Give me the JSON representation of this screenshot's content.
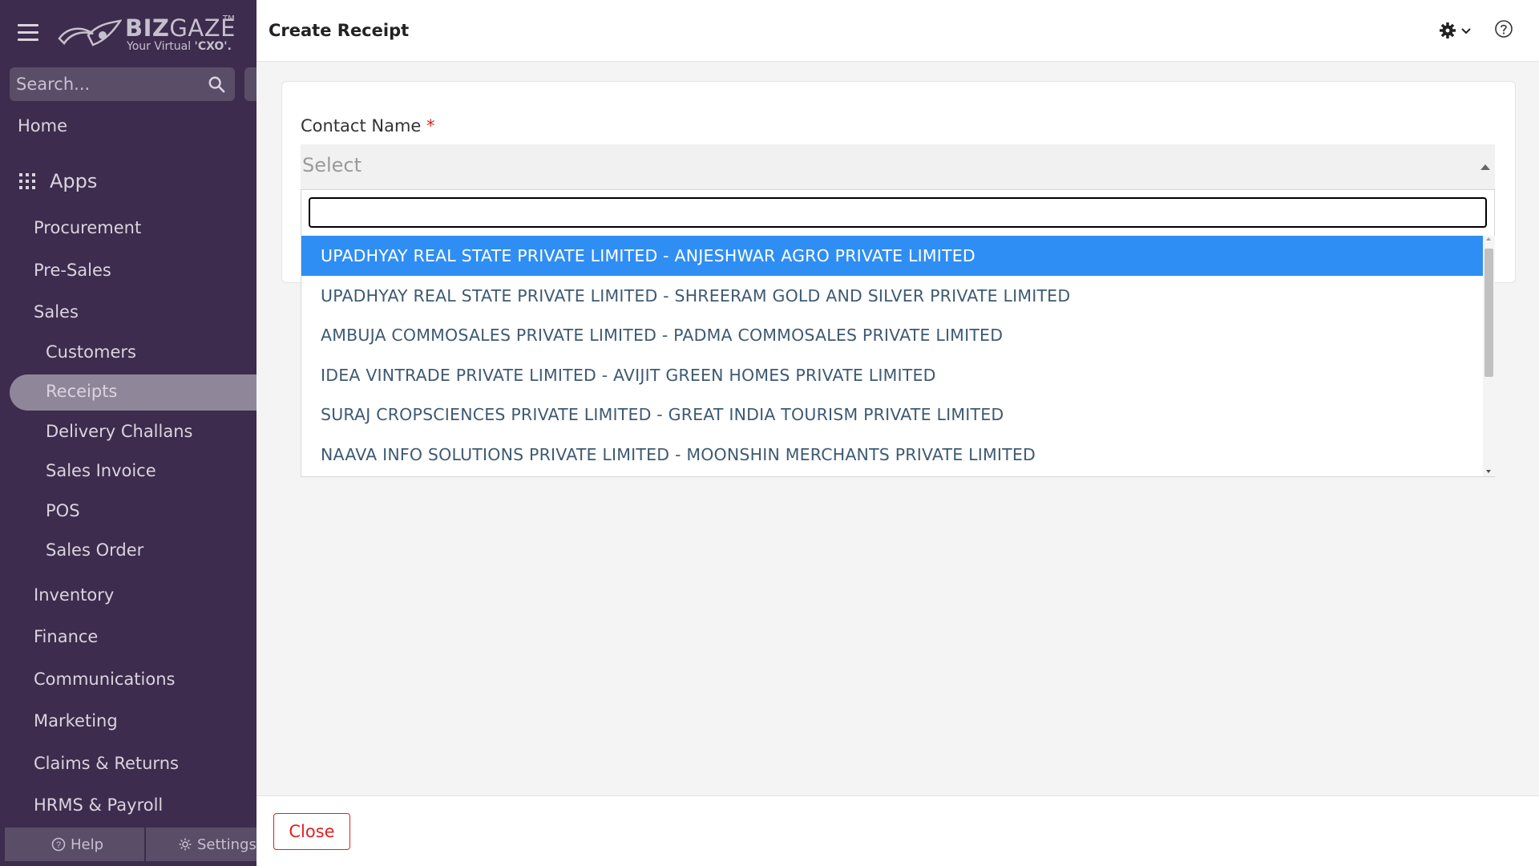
{
  "sidebar": {
    "logo": {
      "brand_bold": "BIZ",
      "brand_light": "GAZE",
      "trademark": "TM",
      "tagline_prefix": "Your Virtual ",
      "tagline_bold": "'CXO'."
    },
    "search": {
      "placeholder": "Search..."
    },
    "home_label": "Home",
    "apps_label": "Apps",
    "items": [
      {
        "label": "Procurement"
      },
      {
        "label": "Pre-Sales"
      },
      {
        "label": "Sales"
      },
      {
        "label": "Customers"
      },
      {
        "label": "Receipts",
        "active": true
      },
      {
        "label": "Delivery Challans"
      },
      {
        "label": "Sales Invoice"
      },
      {
        "label": "POS"
      },
      {
        "label": "Sales Order"
      },
      {
        "label": "Inventory"
      },
      {
        "label": "Finance"
      },
      {
        "label": "Communications"
      },
      {
        "label": "Marketing"
      },
      {
        "label": "Claims & Returns"
      },
      {
        "label": "HRMS & Payroll"
      }
    ],
    "footer": {
      "help_label": "Help",
      "settings_label": "Settings"
    }
  },
  "header": {
    "title": "Create Receipt"
  },
  "form": {
    "contact_label": "Contact Name",
    "required_mark": "*",
    "select_placeholder": "Select"
  },
  "dropdown": {
    "search_value": "",
    "options": [
      {
        "label": "UPADHYAY REAL STATE PRIVATE LIMITED - ANJESHWAR AGRO PRIVATE LIMITED",
        "highlighted": true
      },
      {
        "label": "UPADHYAY REAL STATE PRIVATE LIMITED - SHREERAM GOLD AND SILVER PRIVATE LIMITED"
      },
      {
        "label": "AMBUJA COMMOSALES PRIVATE LIMITED - PADMA COMMOSALES PRIVATE LIMITED"
      },
      {
        "label": "IDEA VINTRADE PRIVATE LIMITED - AVIJIT GREEN HOMES PRIVATE LIMITED"
      },
      {
        "label": "SURAJ CROPSCIENCES PRIVATE LIMITED - GREAT INDIA TOURISM PRIVATE LIMITED"
      },
      {
        "label": "NAAVA INFO SOLUTIONS PRIVATE LIMITED - MOONSHIN MERCHANTS PRIVATE LIMITED"
      }
    ]
  },
  "footer": {
    "close_label": "Close"
  },
  "colors": {
    "sidebar_bg": "#3d2c4d",
    "highlight": "#2f8ef3",
    "danger": "#e02020"
  },
  "icons": [
    "hamburger-icon",
    "search-icon",
    "apps-grid-icon",
    "help-icon",
    "gear-icon",
    "chevron-down-icon",
    "help-circle-icon",
    "caret-up-icon"
  ]
}
